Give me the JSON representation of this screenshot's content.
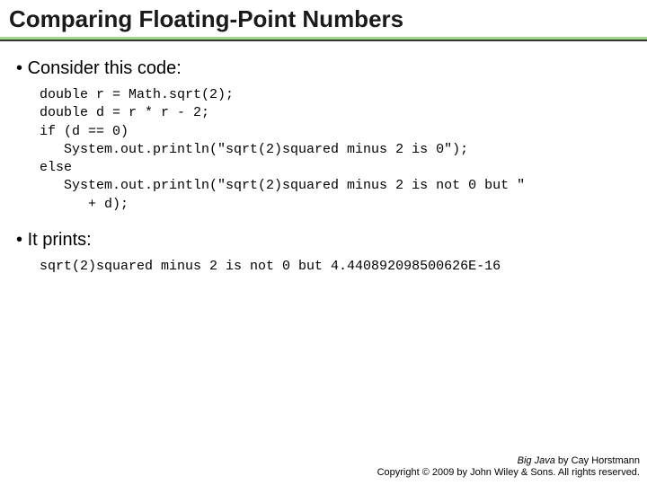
{
  "title": "Comparing Floating-Point Numbers",
  "bullet1": "Consider this code:",
  "code1": "double r = Math.sqrt(2);\ndouble d = r * r - 2;\nif (d == 0)\n   System.out.println(\"sqrt(2)squared minus 2 is 0\");\nelse\n   System.out.println(\"sqrt(2)squared minus 2 is not 0 but \"\n      + d);",
  "bullet2": "It prints:",
  "code2": "sqrt(2)squared minus 2 is not 0 but 4.440892098500626E-16",
  "footer": {
    "book": "Big Java",
    "author": " by Cay Horstmann",
    "copyright": "Copyright © 2009 by John Wiley & Sons. All rights reserved."
  }
}
